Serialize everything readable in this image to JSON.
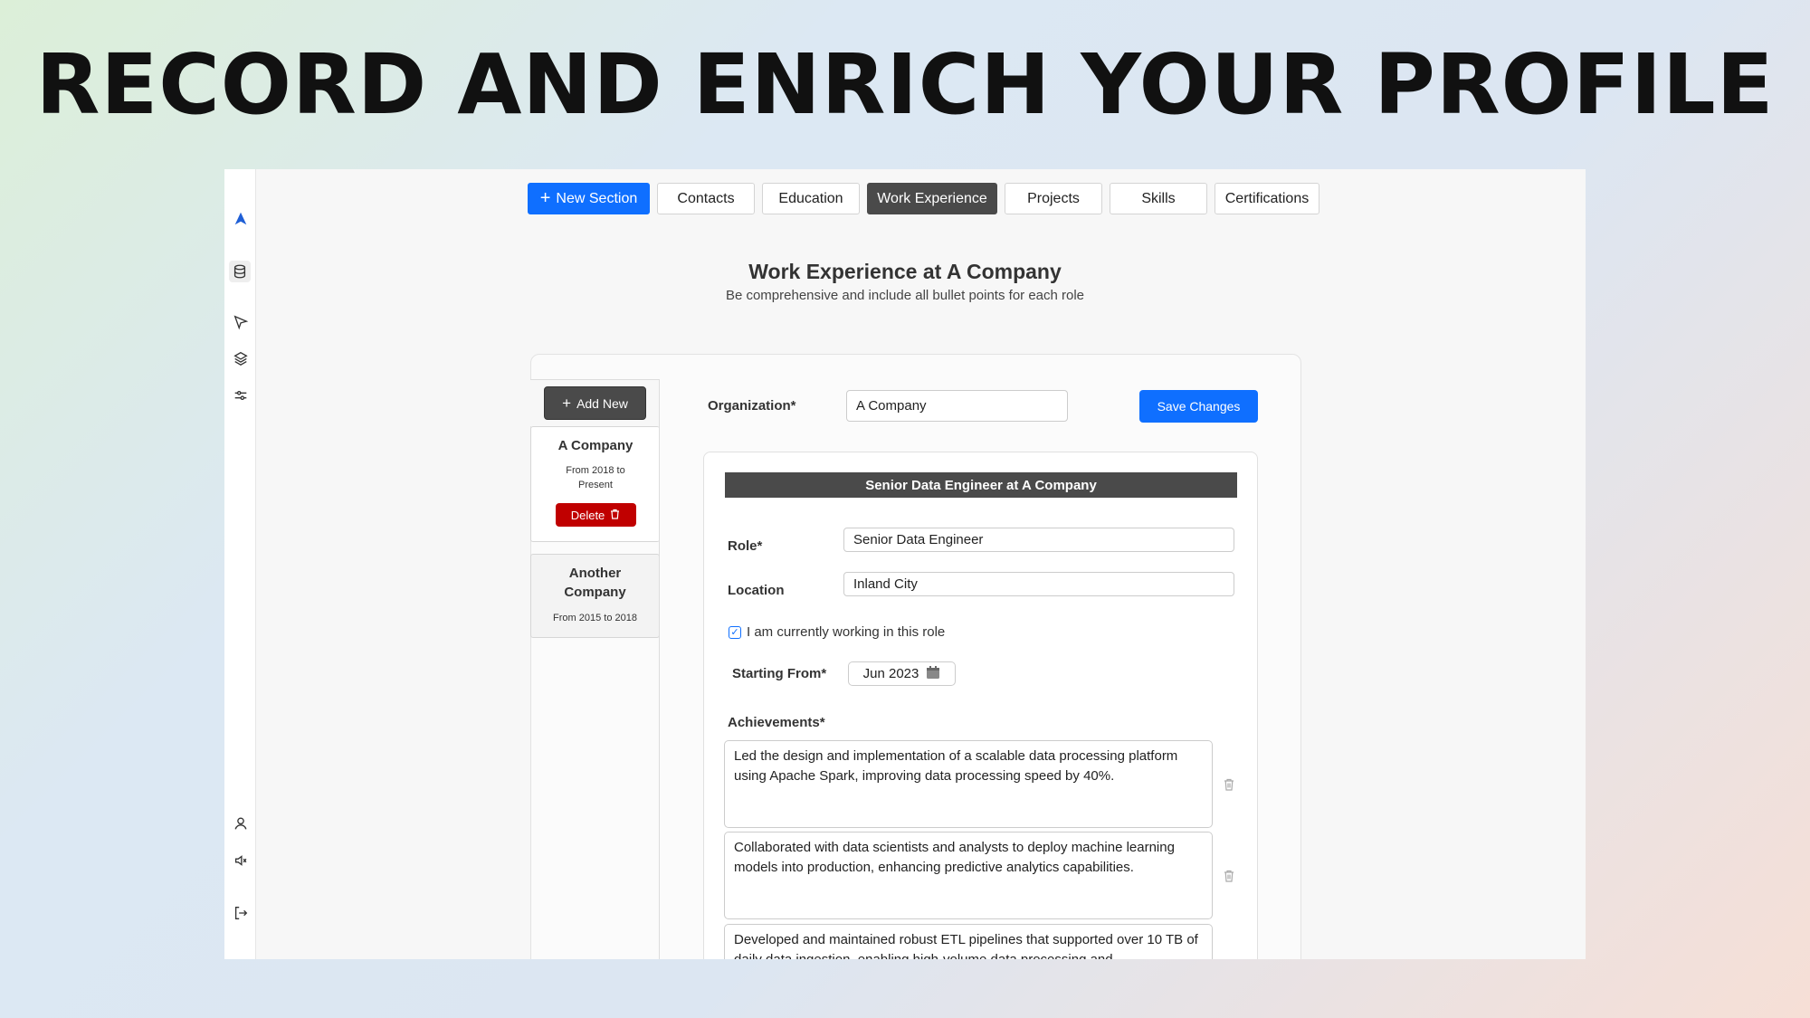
{
  "headline": "RECORD AND ENRICH YOUR PROFILE",
  "sidebar": {
    "icons": [
      "logo-arrow-icon",
      "database-icon",
      "send-icon",
      "layers-icon",
      "sliders-icon",
      "user-icon",
      "speaker-icon",
      "logout-icon"
    ]
  },
  "tabs": {
    "new_section": "New Section",
    "contacts": "Contacts",
    "education": "Education",
    "work_experience": "Work Experience",
    "projects": "Projects",
    "skills": "Skills",
    "certifications": "Certifications"
  },
  "page": {
    "title": "Work Experience at A Company",
    "subtitle": "Be comprehensive and include all bullet points for each role"
  },
  "list": {
    "add_new": "Add New",
    "items": [
      {
        "name": "A Company",
        "dates": "From 2018 to Present",
        "delete": "Delete"
      },
      {
        "name": "Another Company",
        "dates": "From 2015 to 2018"
      }
    ]
  },
  "form": {
    "organization_label": "Organization*",
    "organization_value": "A Company",
    "save": "Save Changes",
    "role_header": "Senior Data Engineer at A Company",
    "role_label": "Role*",
    "role_value": "Senior Data Engineer",
    "location_label": "Location",
    "location_value": "Inland City",
    "current_label": "I am currently working in this role",
    "starting_label": "Starting From*",
    "starting_value": "Jun 2023",
    "achievements_label": "Achievements*",
    "achievements": [
      "Led the design and implementation of a scalable data processing platform using Apache Spark, improving data processing speed by 40%.",
      "Collaborated with data scientists and analysts to deploy machine learning models into production, enhancing predictive analytics capabilities.",
      "Developed and maintained robust ETL pipelines that supported over 10 TB of daily data ingestion, enabling high-volume data processing and"
    ]
  },
  "colors": {
    "primary": "#0f6fff",
    "dark": "#4a4a4a",
    "danger": "#c00000"
  }
}
